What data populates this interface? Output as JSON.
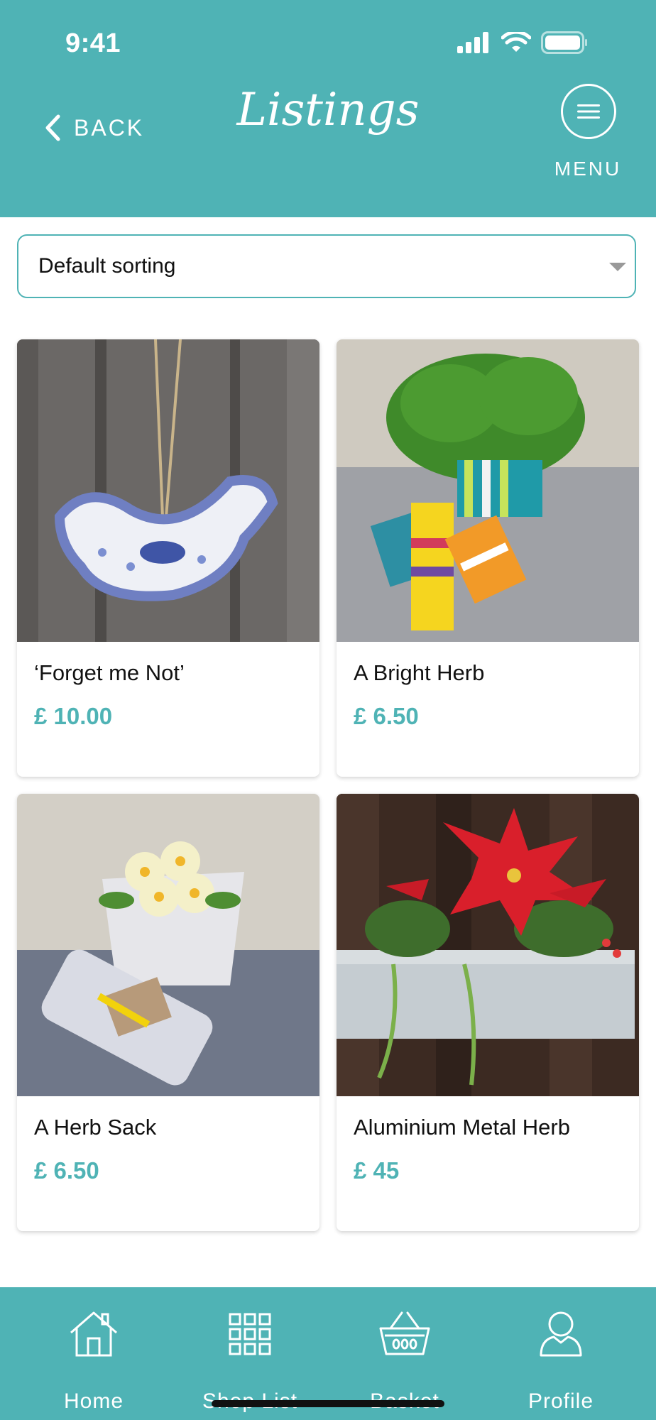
{
  "status_bar": {
    "time": "9:41"
  },
  "header": {
    "back_label": "BACK",
    "title": "Listings",
    "menu_label": "MENU"
  },
  "sort": {
    "selected": "Default sorting"
  },
  "products": [
    {
      "name": "‘Forget me Not’",
      "price": "£ 10.00"
    },
    {
      "name": "A Bright Herb",
      "price": "£ 6.50"
    },
    {
      "name": "A Herb Sack",
      "price": "£ 6.50"
    },
    {
      "name": "Aluminium Metal Herb",
      "price": "£ 45"
    }
  ],
  "tabbar": {
    "items": [
      {
        "label": "Home",
        "icon": "home-icon"
      },
      {
        "label": "Shop List",
        "icon": "grid-icon"
      },
      {
        "label": "Basket",
        "icon": "basket-icon"
      },
      {
        "label": "Profile",
        "icon": "profile-icon"
      }
    ]
  },
  "colors": {
    "accent": "#4fb3b5"
  }
}
